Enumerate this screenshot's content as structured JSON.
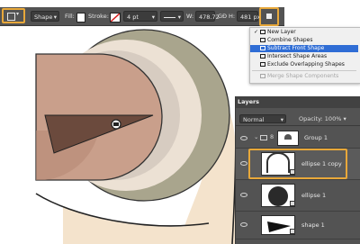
{
  "options_bar": {
    "mode": "Shape",
    "fill_label": "Fill:",
    "stroke_label": "Stroke:",
    "stroke_width": "4 pt",
    "w_label": "W:",
    "w_value": "478.72",
    "link_glyph": "GĐ",
    "h_label": "H:",
    "h_value": "481 px"
  },
  "path_ops_menu": {
    "items": [
      {
        "label": "New Layer",
        "checked": true,
        "selected": false,
        "disabled": false
      },
      {
        "label": "Combine Shapes",
        "checked": false,
        "selected": false,
        "disabled": false
      },
      {
        "label": "Subtract Front Shape",
        "checked": false,
        "selected": true,
        "disabled": false
      },
      {
        "label": "Intersect Shape Areas",
        "checked": false,
        "selected": false,
        "disabled": false
      },
      {
        "label": "Exclude Overlapping Shapes",
        "checked": false,
        "selected": false,
        "disabled": false
      },
      {
        "label": "Merge Shape Components",
        "checked": false,
        "selected": false,
        "disabled": true
      }
    ]
  },
  "layers_panel": {
    "tab": "Layers",
    "blend_mode": "Normal",
    "opacity_label": "Opacity:",
    "opacity_value": "100%",
    "layers": [
      {
        "name": "Group 1",
        "type": "group"
      },
      {
        "name": "ellipse 1 copy",
        "type": "shape",
        "highlighted": true
      },
      {
        "name": "ellipse 1",
        "type": "shape"
      },
      {
        "name": "shape 1",
        "type": "shape"
      }
    ]
  },
  "colors": {
    "accent": "#e8a83a",
    "menu_selection": "#2f6dd5",
    "panel_bg": "#535353",
    "head_fill": "#c99f8b",
    "ring_outer": "#a9a58d",
    "ring_inner": "#d7ccc1",
    "body_fill": "#f4e3cc"
  }
}
